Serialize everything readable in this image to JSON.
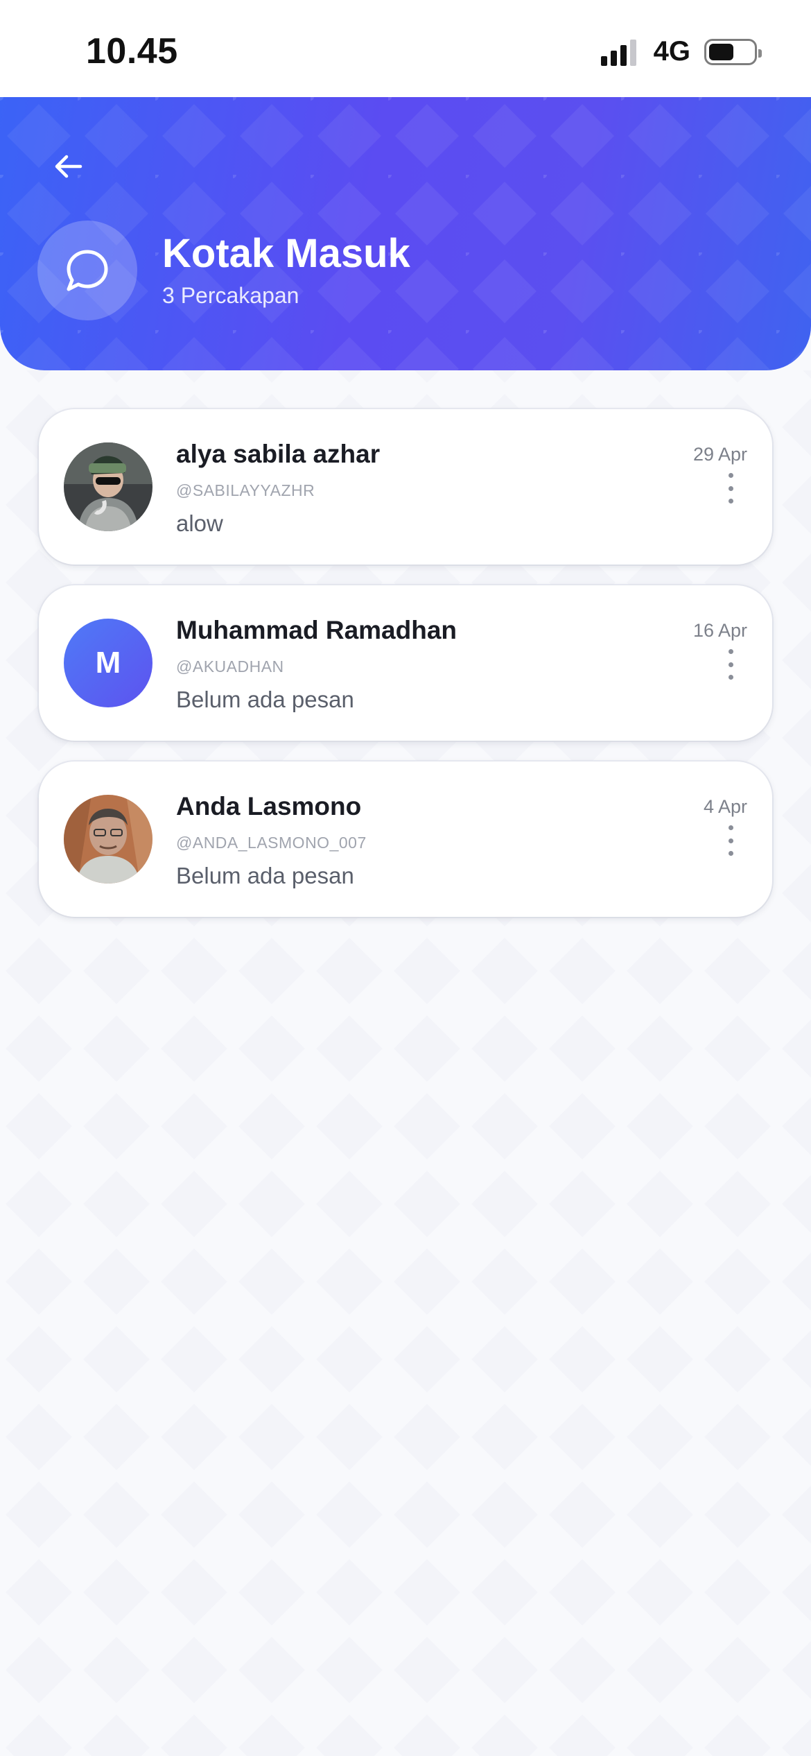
{
  "status_bar": {
    "time": "10.45",
    "network": "4G",
    "battery_level": 0.55
  },
  "header": {
    "title": "Kotak Masuk",
    "subtitle": "3 Percakapan",
    "back_icon": "arrow-left-icon",
    "header_icon": "chat-bubble-icon",
    "gradient_colors": [
      "#3b63f6",
      "#5b4cf2",
      "#3f63f0"
    ]
  },
  "conversations": [
    {
      "name": "alya sabila azhar",
      "handle": "@SABILAYYAZHR",
      "last_message": "alow",
      "date": "29 Apr",
      "avatar_type": "photo",
      "menu_icon": "more-vertical-icon"
    },
    {
      "name": "Muhammad Ramadhan",
      "handle": "@AKUADHAN",
      "last_message": "Belum ada pesan",
      "date": "16 Apr",
      "avatar_type": "initial",
      "avatar_initial": "M",
      "menu_icon": "more-vertical-icon"
    },
    {
      "name": "Anda Lasmono",
      "handle": "@ANDA_LASMONO_007",
      "last_message": "Belum ada pesan",
      "date": "4 Apr",
      "avatar_type": "photo",
      "menu_icon": "more-vertical-icon"
    }
  ]
}
